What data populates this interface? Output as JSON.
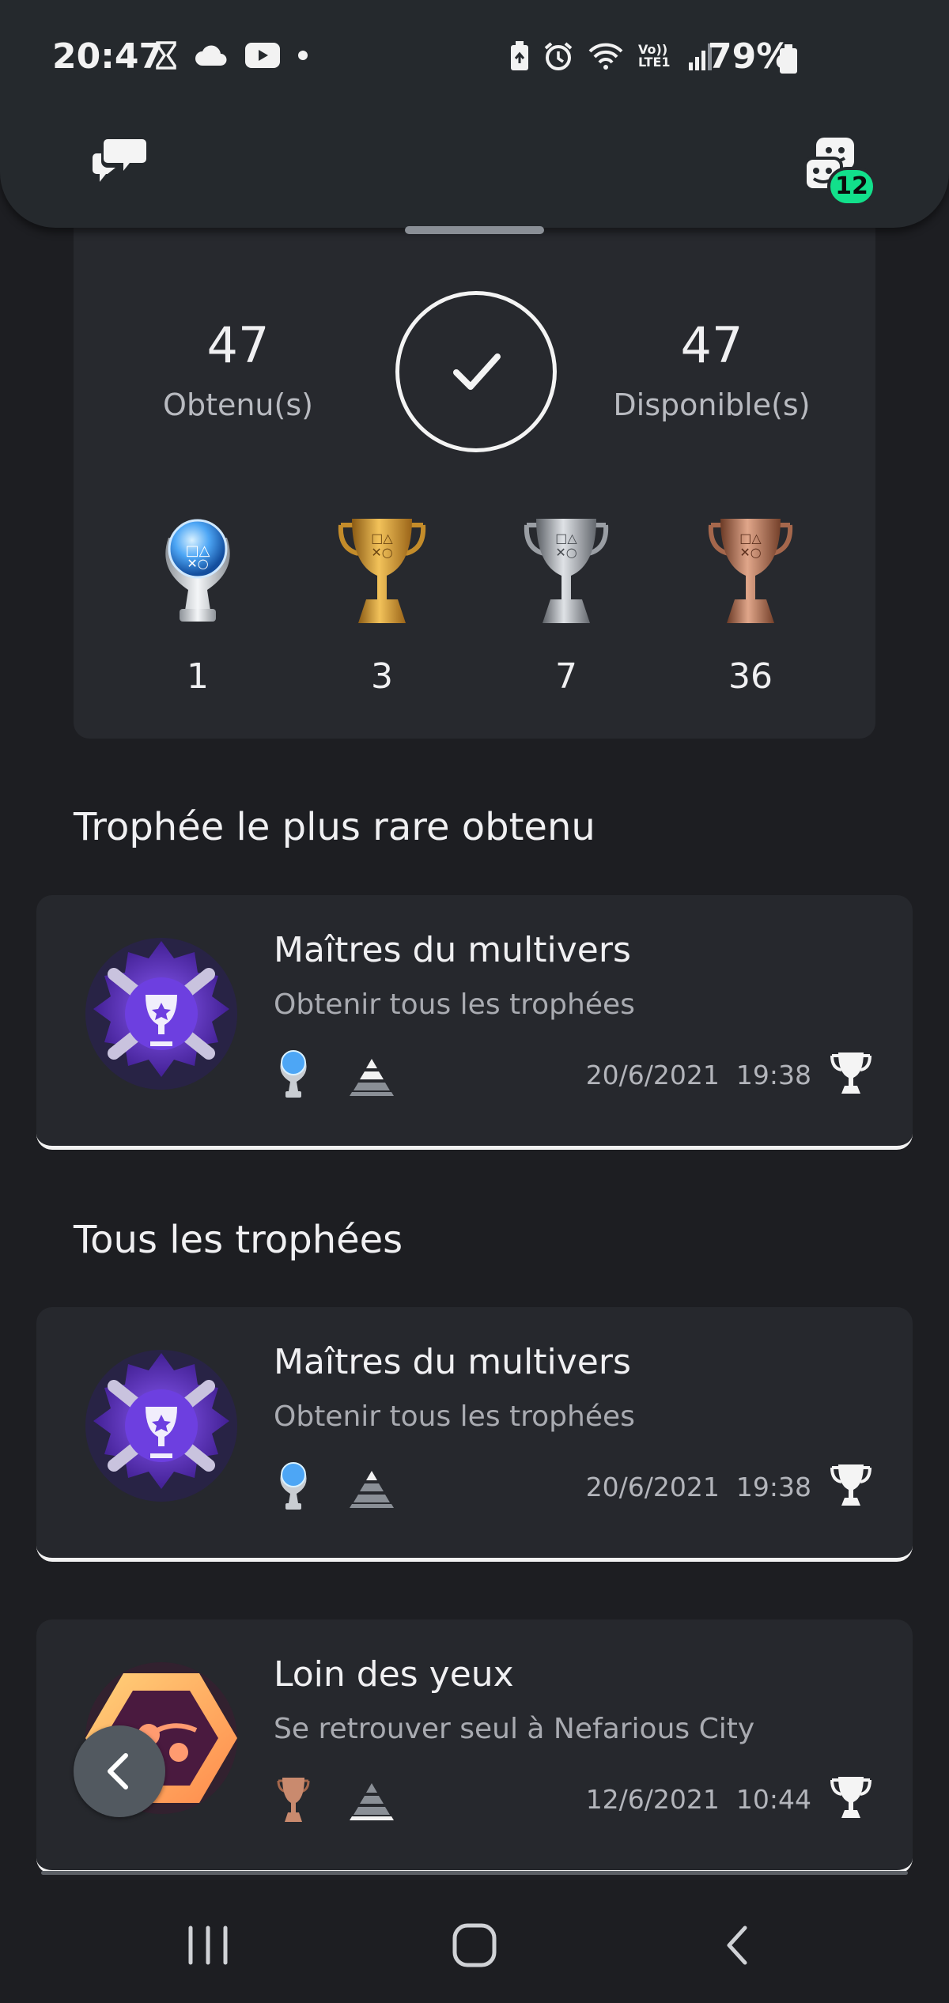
{
  "status_bar": {
    "time": "20:47",
    "battery_percent": "79%",
    "left_icons": [
      "hourglass-icon",
      "cloud-icon",
      "youtube-icon",
      "dot-icon"
    ],
    "right_icons": [
      "battery-saver-icon",
      "alarm-icon",
      "wifi-icon",
      "volte-icon",
      "signal-icon",
      "battery-icon"
    ],
    "volte_label": "Vo)) LTE1"
  },
  "header": {
    "chat_icon": "chat-bubbles-icon",
    "party_icon": "party-icon",
    "party_badge": "12",
    "badge_color": "#12e08b"
  },
  "summary": {
    "earned_count": "47",
    "earned_label": "Obtenu(s)",
    "available_count": "47",
    "available_label": "Disponible(s)",
    "completion_icon": "check-icon",
    "trophy_counts": [
      {
        "grade": "platinum",
        "count": "1"
      },
      {
        "grade": "gold",
        "count": "3"
      },
      {
        "grade": "silver",
        "count": "7"
      },
      {
        "grade": "bronze",
        "count": "36"
      }
    ]
  },
  "rarest_section": {
    "title": "Trophée le plus rare obtenu",
    "card": {
      "title": "Maîtres du multivers",
      "description": "Obtenir tous les trophées",
      "grade": "platinum",
      "date": "20/6/2021",
      "time": "19:38"
    }
  },
  "all_section": {
    "title": "Tous les trophées",
    "cards": [
      {
        "title": "Maîtres du multivers",
        "description": "Obtenir tous les trophées",
        "grade": "platinum",
        "date": "20/6/2021",
        "time": "19:38"
      },
      {
        "title": "Loin des yeux",
        "description": "Se retrouver seul à Nefarious City",
        "grade": "bronze",
        "date": "12/6/2021",
        "time": "10:44"
      }
    ]
  },
  "colors": {
    "background": "#1d1e22",
    "card": "#26282d",
    "platinum": "#6fb8ff",
    "gold": "#d9a43a",
    "silver": "#bfc3c8",
    "bronze": "#c98a6e"
  }
}
